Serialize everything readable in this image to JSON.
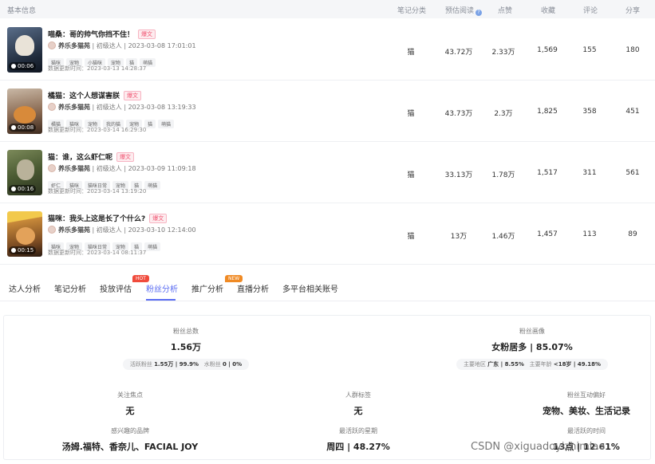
{
  "table_header": {
    "basic_info": "基本信息",
    "category": "笔记分类",
    "est_reads": "预估阅读",
    "likes": "点赞",
    "favorites": "收藏",
    "comments": "评论",
    "shares": "分享"
  },
  "notes": [
    {
      "title": "喵桑：哥的帅气你挡不住！",
      "badge": "爆文",
      "author": "养乐多猫苑",
      "level": "初级达人",
      "published": "2023-03-08 17:01:01",
      "tags": [
        "猫咪",
        "宠物",
        "小猫咪",
        "宠物",
        "猫",
        "萌猫"
      ],
      "updated": "数据更新时间：2023-03-13 14:28:37",
      "duration": "00:06",
      "category": "猫",
      "reads": "43.72万",
      "likes": "2.33万",
      "favorites": "1,569",
      "comments": "155",
      "shares": "180"
    },
    {
      "title": "橘猫：这个人想谋害朕",
      "badge": "爆文",
      "author": "养乐多猫苑",
      "level": "初级达人",
      "published": "2023-03-08 13:19:33",
      "tags": [
        "橘猫",
        "猫咪",
        "宠物",
        "我的猫",
        "宠物",
        "猫",
        "萌猫"
      ],
      "updated": "数据更新时间：2023-03-14 16:29:30",
      "duration": "00:08",
      "category": "猫",
      "reads": "43.73万",
      "likes": "2.3万",
      "favorites": "1,825",
      "comments": "358",
      "shares": "451"
    },
    {
      "title": "猫：谁，这么虾仁呢",
      "badge": "爆文",
      "author": "养乐多猫苑",
      "level": "初级达人",
      "published": "2023-03-09 11:09:18",
      "tags": [
        "虾仁",
        "猫咪",
        "猫咪日常",
        "宠物",
        "猫",
        "萌猫"
      ],
      "updated": "数据更新时间：2023-03-14 13:19:20",
      "duration": "00:16",
      "category": "猫",
      "reads": "33.13万",
      "likes": "1.78万",
      "favorites": "1,517",
      "comments": "311",
      "shares": "561"
    },
    {
      "title": "猫咪：我头上这是长了个什么?",
      "badge": "爆文",
      "author": "养乐多猫苑",
      "level": "初级达人",
      "published": "2023-03-10 12:14:00",
      "tags": [
        "猫咪",
        "宠物",
        "猫咪日常",
        "宠物",
        "猫",
        "萌猫"
      ],
      "updated": "数据更新时间：2023-03-14 08:11:37",
      "duration": "00:15",
      "category": "猫",
      "reads": "13万",
      "likes": "1.46万",
      "favorites": "1,457",
      "comments": "113",
      "shares": "89"
    }
  ],
  "tabs": [
    {
      "label": "达人分析"
    },
    {
      "label": "笔记分析"
    },
    {
      "label": "投放评估"
    },
    {
      "label": "粉丝分析",
      "badge": "HOT"
    },
    {
      "label": "推广分析"
    },
    {
      "label": "直播分析",
      "badge": "NEW"
    },
    {
      "label": "多平台相关账号"
    }
  ],
  "fans": {
    "total_label": "粉丝总数",
    "total_value": "1.56万",
    "active_label": "活跃粉丝",
    "active_value": "1.55万 | 99.9%",
    "bot_label": "水粉丝",
    "bot_value": "0 | 0%",
    "portrait_label": "粉丝画像",
    "portrait_value": "女粉居多 | 85.07%",
    "region_label": "主要地区",
    "region_value": "广东 | 8.55%",
    "age_label": "主要年龄",
    "age_value": "<18岁 | 49.18%",
    "focus_label": "关注焦点",
    "focus_value": "无",
    "crowd_label": "人群标签",
    "crowd_value": "无",
    "interact_label": "粉丝互动偏好",
    "interact_value": "宠物、美妆、生活记录",
    "brand_label": "感兴趣的品牌",
    "brand_value": "汤姆.福特、香奈儿、FACIAL JOY",
    "week_label": "最活跃的星期",
    "week_value": "周四 | 48.27%",
    "time_label": "最活跃的时间",
    "time_value": "13点 | 12.61%"
  },
  "watermark": "CSDN @xiguadoyizhimiao",
  "colors": {
    "accent": "#5b6df2",
    "hot_badge": "#f04b3c",
    "new_badge": "#f08a24",
    "viral_badge": "#f0506e"
  }
}
